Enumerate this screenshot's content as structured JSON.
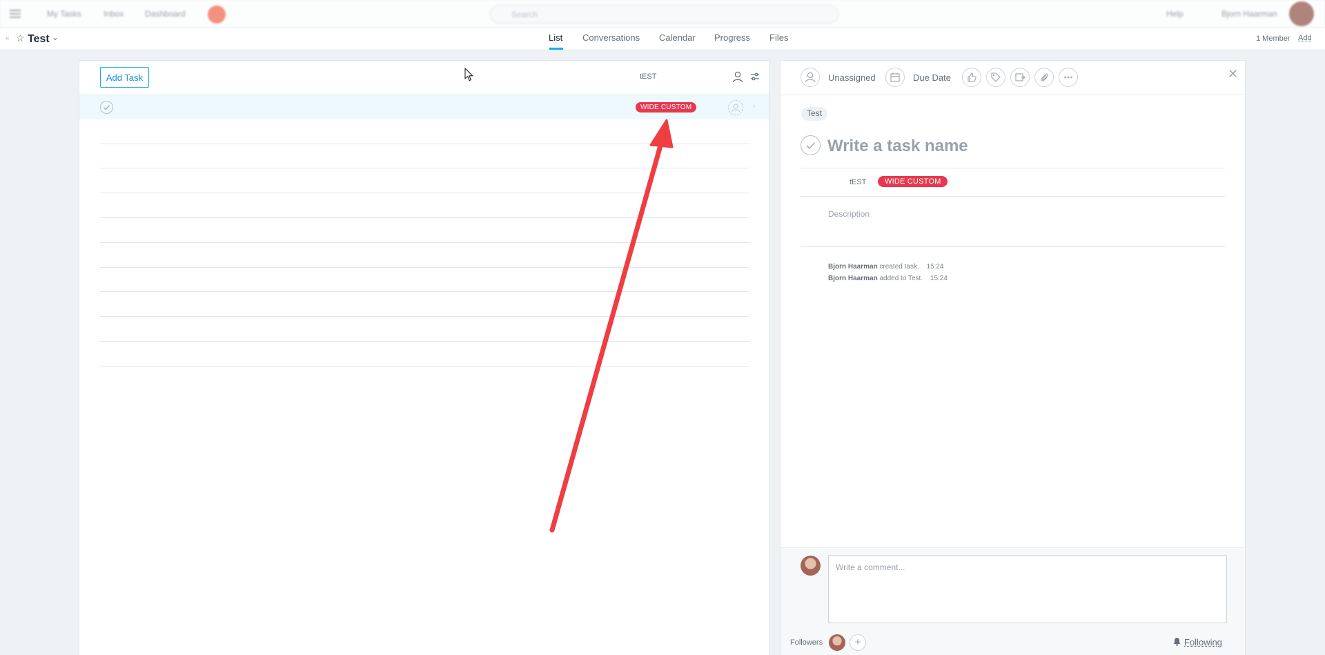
{
  "topbar": {
    "links": [
      "My Tasks",
      "Inbox",
      "Dashboard"
    ],
    "search_placeholder": "Search",
    "help": "Help",
    "user": "Bjorn Haarman"
  },
  "project": {
    "name": "Test",
    "members": "1 Member",
    "add": "Add"
  },
  "tabs": [
    "List",
    "Conversations",
    "Calendar",
    "Progress",
    "Files"
  ],
  "list": {
    "add_task_label": "Add Task",
    "column_header": "tEST",
    "row_tag": "WIDE CUSTOM"
  },
  "detail": {
    "assignee": "Unassigned",
    "due_date": "Due Date",
    "project_chip": "Test",
    "task_name_placeholder": "Write a task name",
    "field_name": "tEST",
    "field_value": "WIDE CUSTOM",
    "description_placeholder": "Description",
    "activity": [
      {
        "user": "Bjorn Haarman",
        "action": "created task.",
        "time": "15:24"
      },
      {
        "user": "Bjorn Haarman",
        "action": "added to Test.",
        "time": "15:24"
      }
    ],
    "comment_placeholder": "Write a comment...",
    "followers_label": "Followers",
    "following_label": "Following"
  },
  "colors": {
    "accent": "#14aaf5",
    "tag_red": "#e8384f",
    "annotation_arrow": "#ef3e42"
  }
}
